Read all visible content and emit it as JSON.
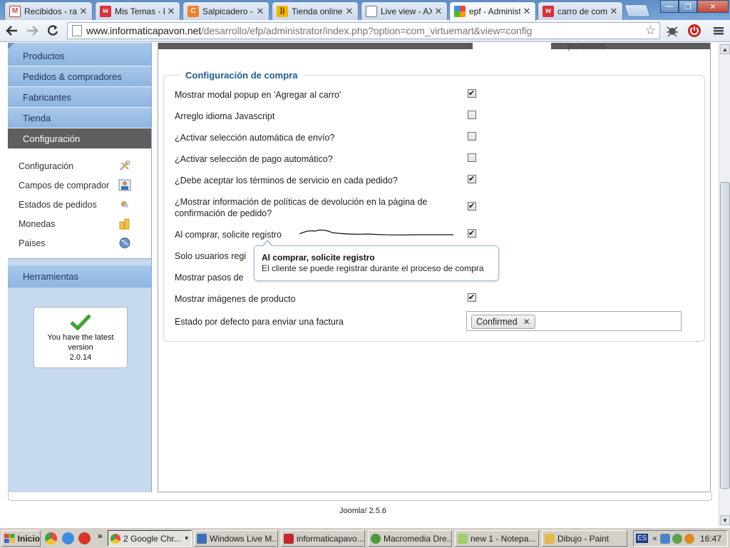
{
  "browser": {
    "tabs": [
      {
        "title": "Recibidos - ral",
        "icon": "gmail-icon"
      },
      {
        "title": "Mis Temas - F",
        "icon": "site-w-icon"
      },
      {
        "title": "Salpicadero - l",
        "icon": "salpicadero-icon"
      },
      {
        "title": "Tienda online",
        "icon": "sound-icon"
      },
      {
        "title": "Live view - AX",
        "icon": "page-icon"
      },
      {
        "title": "epf - Administ",
        "icon": "joomla-icon"
      },
      {
        "title": "carro de comp",
        "icon": "site-w-icon"
      }
    ],
    "url_host": "www.informaticapavon.net",
    "url_path": "/desarrollo/efp/administrator/index.php?option=com_virtuemart&view=config"
  },
  "sidebar": {
    "items": [
      {
        "label": "Productos"
      },
      {
        "label": "Pedidos & compradores"
      },
      {
        "label": "Fabricantes"
      },
      {
        "label": "Tienda"
      },
      {
        "label": "Configuración"
      }
    ],
    "subitems": [
      {
        "label": "Configuración",
        "icon": "tools-icon"
      },
      {
        "label": "Campos de comprador",
        "icon": "user-fields-icon"
      },
      {
        "label": "Estados de pedidos",
        "icon": "order-status-icon"
      },
      {
        "label": "Monedas",
        "icon": "currency-icon"
      },
      {
        "label": "Paises",
        "icon": "globe-icon"
      }
    ],
    "tools_label": "Herramientas",
    "version": {
      "line1": "You have the latest",
      "line2": "version",
      "line3": "2.0.14"
    }
  },
  "main": {
    "clipped_top_text": "productos",
    "legend": "Configuración de compra",
    "rows": [
      {
        "label": "Mostrar modal popup en 'Agregar al carro'",
        "checked": true
      },
      {
        "label": "Arreglo idioma Javascript",
        "checked": false
      },
      {
        "label": "¿Activar selección automática de envío?",
        "checked": false
      },
      {
        "label": "¿Activar selección de pago automático?",
        "checked": false
      },
      {
        "label": "¿Debe aceptar los términos de servicio en cada pedido?",
        "checked": true
      },
      {
        "label": "¿Mostrar información de políticas de devolución en la página de confirmación de pedido?",
        "checked": true
      },
      {
        "label": "Al comprar, solicite registro",
        "checked": true
      },
      {
        "label": "Solo usuarios regi",
        "checked": null
      },
      {
        "label": "Mostrar pasos de",
        "checked": null
      },
      {
        "label": "Mostrar imágenes de producto",
        "checked": true
      }
    ],
    "invoice_label": "Estado por defecto para enviar una factura",
    "invoice_tag": "Confirmed",
    "tooltip": {
      "title": "Al comprar, solicite registro",
      "body": "El cliente se puede registrar durante el proceso de compra"
    },
    "footer": "Joomla! 2.5.6"
  },
  "taskbar": {
    "start": "Inicio",
    "tasks": [
      {
        "label": "2 Google Chr...",
        "icon": "chrome-icon",
        "pressed": true
      },
      {
        "label": "Windows Live M...",
        "icon": "windows-live-icon",
        "pressed": false
      },
      {
        "label": "informaticapavo...",
        "icon": "filezilla-icon",
        "pressed": false
      },
      {
        "label": "Macromedia Dre...",
        "icon": "dreamweaver-icon",
        "pressed": false
      },
      {
        "label": "new 1 - Notepa...",
        "icon": "notepad-icon",
        "pressed": false
      },
      {
        "label": "Dibujo - Paint",
        "icon": "paint-icon",
        "pressed": false
      }
    ],
    "clock": "16:47",
    "lang": "ES"
  }
}
